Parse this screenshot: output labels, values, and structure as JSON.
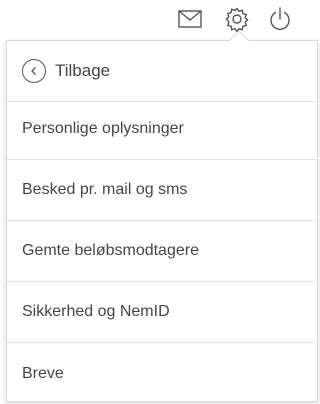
{
  "header": {
    "icons": [
      {
        "name": "mail-icon"
      },
      {
        "name": "gear-icon"
      },
      {
        "name": "power-icon"
      }
    ]
  },
  "menu": {
    "back_label": "Tilbage",
    "items": [
      {
        "label": "Personlige oplysninger"
      },
      {
        "label": "Besked pr. mail og sms"
      },
      {
        "label": "Gemte beløbsmodtagere"
      },
      {
        "label": "Sikkerhed og NemID"
      },
      {
        "label": "Breve"
      }
    ]
  },
  "colors": {
    "text": "#454545",
    "divider": "#e1e1e1",
    "icon": "#555555"
  }
}
